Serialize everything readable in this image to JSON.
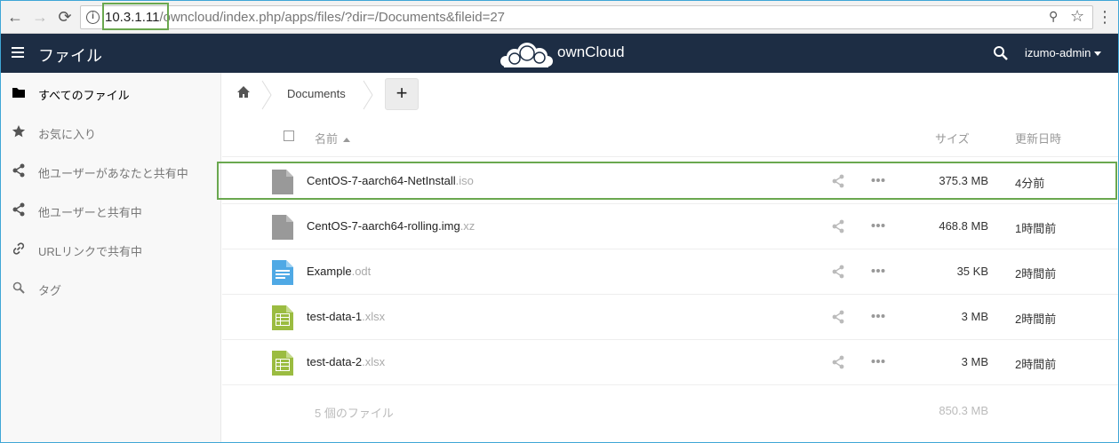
{
  "browser": {
    "back_glyph": "←",
    "forward_glyph": "→",
    "reload_glyph": "⟳",
    "url_host": "10.3.1.11",
    "url_rest": "/owncloud/index.php/apps/files/?dir=/Documents&fileid=27",
    "info_glyph": "i",
    "star_glyph": "☆",
    "menu_glyph": "⋮",
    "key_glyph": "⚲"
  },
  "header": {
    "app_title": "ファイル",
    "brand": "ownCloud",
    "user": "izumo-admin"
  },
  "sidebar": {
    "items": [
      {
        "label": "すべてのファイル",
        "icon": "folder-icon"
      },
      {
        "label": "お気に入り",
        "icon": "star-icon"
      },
      {
        "label": "他ユーザーがあなたと共有中",
        "icon": "share-icon"
      },
      {
        "label": "他ユーザーと共有中",
        "icon": "share-icon"
      },
      {
        "label": "URLリンクで共有中",
        "icon": "link-icon"
      },
      {
        "label": "タグ",
        "icon": "search-icon"
      }
    ]
  },
  "breadcrumb": {
    "current": "Documents",
    "new_label": "+"
  },
  "table": {
    "col_name": "名前",
    "col_size": "サイズ",
    "col_modified": "更新日時",
    "rows": [
      {
        "base": "CentOS-7-aarch64-NetInstall",
        "ext": ".iso",
        "size": "375.3 MB",
        "modified": "4分前",
        "type": "generic"
      },
      {
        "base": "CentOS-7-aarch64-rolling.img",
        "ext": ".xz",
        "size": "468.8 MB",
        "modified": "1時間前",
        "type": "generic"
      },
      {
        "base": "Example",
        "ext": ".odt",
        "size": "35 KB",
        "modified": "2時間前",
        "type": "document"
      },
      {
        "base": "test-data-1",
        "ext": ".xlsx",
        "size": "3 MB",
        "modified": "2時間前",
        "type": "spreadsheet"
      },
      {
        "base": "test-data-2",
        "ext": ".xlsx",
        "size": "3 MB",
        "modified": "2時間前",
        "type": "spreadsheet"
      }
    ],
    "summary_files": "5 個のファイル",
    "summary_size": "850.3 MB"
  },
  "colors": {
    "header_bg": "#1d2d44",
    "highlight": "#6aa84f",
    "doc_icon": "#4fa9e5",
    "sheet_icon": "#9bbc41",
    "generic_icon": "#999999"
  }
}
